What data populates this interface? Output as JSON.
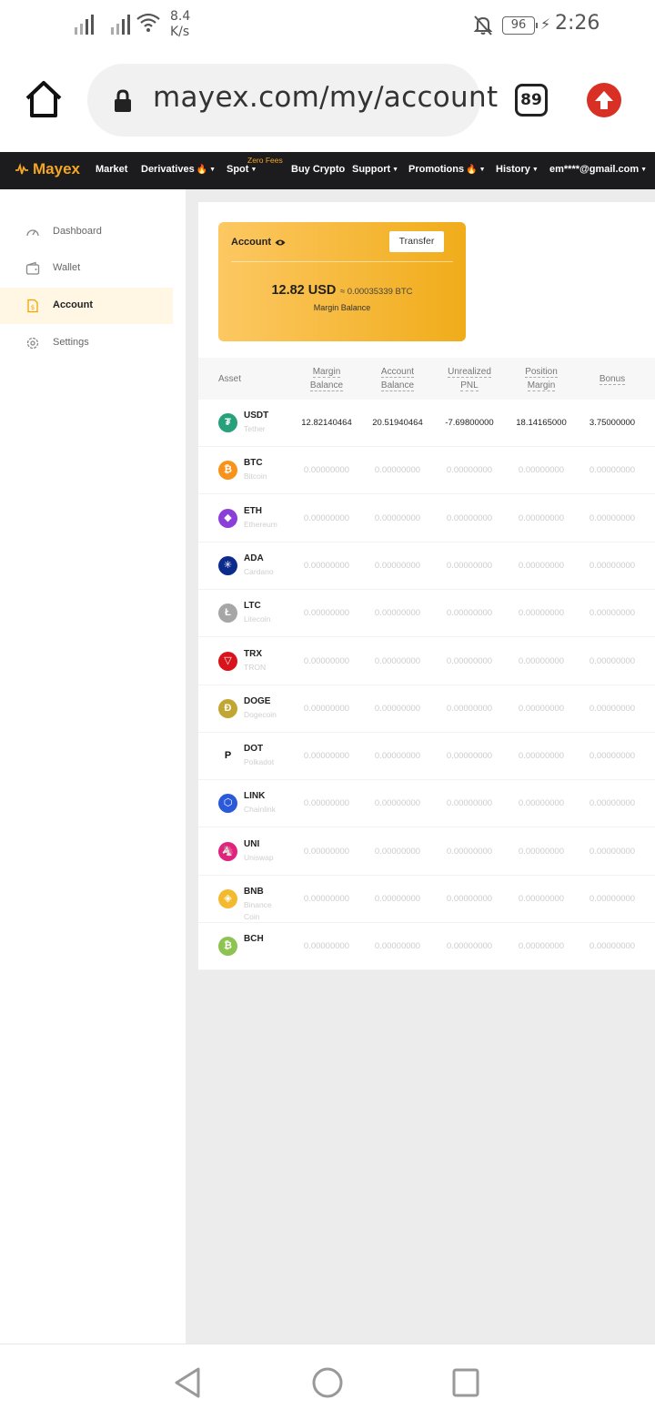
{
  "status_bar": {
    "speed_value": "8.4",
    "speed_unit": "K/s",
    "battery": "96",
    "time": "2:26"
  },
  "browser": {
    "url": "mayex.com/my/account",
    "tab_count": "89"
  },
  "site_nav": {
    "logo": "Mayex",
    "items": {
      "market": "Market",
      "derivatives": "Derivatives",
      "spot": "Spot",
      "spot_badge": "Zero Fees",
      "buy_crypto": "Buy Crypto",
      "support": "Support",
      "promotions": "Promotions",
      "history": "History",
      "account_email": "em****@gmail.com"
    }
  },
  "sidebar": {
    "items": [
      {
        "label": "Dashboard",
        "icon": "dashboard-icon"
      },
      {
        "label": "Wallet",
        "icon": "wallet-icon"
      },
      {
        "label": "Account",
        "icon": "account-icon",
        "active": true
      },
      {
        "label": "Settings",
        "icon": "settings-icon"
      }
    ]
  },
  "account_card": {
    "title": "Account",
    "transfer_label": "Transfer",
    "balance_usd": "12.82 USD",
    "balance_btc": "≈ 0.00035339 BTC",
    "balance_label": "Margin Balance"
  },
  "table": {
    "columns": {
      "asset": "Asset",
      "margin_balance": [
        "Margin",
        "Balance"
      ],
      "account_balance": [
        "Account",
        "Balance"
      ],
      "unrealized_pnl": [
        "Unrealized",
        "PNL"
      ],
      "position_margin": [
        "Position",
        "Margin"
      ],
      "bonus": "Bonus"
    },
    "rows": [
      {
        "symbol": "USDT",
        "name": "Tether",
        "color": "#26a17b",
        "glyph": "₮",
        "values": [
          "12.82140464",
          "20.51940464",
          "-7.69800000",
          "18.14165000",
          "3.75000000"
        ],
        "active": true
      },
      {
        "symbol": "BTC",
        "name": "Bitcoin",
        "color": "#f7931a",
        "glyph": "₿",
        "values": [
          "0.00000000",
          "0.00000000",
          "0.00000000",
          "0.00000000",
          "0.00000000"
        ]
      },
      {
        "symbol": "ETH",
        "name": "Ethereum",
        "color": "#8c3fd8",
        "glyph": "◆",
        "values": [
          "0.00000000",
          "0.00000000",
          "0.00000000",
          "0.00000000",
          "0.00000000"
        ]
      },
      {
        "symbol": "ADA",
        "name": "Cardano",
        "color": "#0d2b8c",
        "glyph": "✳",
        "values": [
          "0.00000000",
          "0.00000000",
          "0.00000000",
          "0.00000000",
          "0.00000000"
        ]
      },
      {
        "symbol": "LTC",
        "name": "Litecoin",
        "color": "#a6a6a6",
        "glyph": "Ł",
        "values": [
          "0.00000000",
          "0.00000000",
          "0.00000000",
          "0.00000000",
          "0.00000000"
        ]
      },
      {
        "symbol": "TRX",
        "name": "TRON",
        "color": "#d8131b",
        "glyph": "▽",
        "values": [
          "0.00000000",
          "0.00000000",
          "0.00000000",
          "0.00000000",
          "0.00000000"
        ]
      },
      {
        "symbol": "DOGE",
        "name": "Dogecoin",
        "color": "#c2a633",
        "glyph": "Ð",
        "values": [
          "0.00000000",
          "0.00000000",
          "0.00000000",
          "0.00000000",
          "0.00000000"
        ]
      },
      {
        "symbol": "DOT",
        "name": "Polkadot",
        "color": "#ffffff",
        "glyph": "P",
        "values": [
          "0.00000000",
          "0.00000000",
          "0.00000000",
          "0.00000000",
          "0.00000000"
        ]
      },
      {
        "symbol": "LINK",
        "name": "Chainlink",
        "color": "#2a5ada",
        "glyph": "⬡",
        "values": [
          "0.00000000",
          "0.00000000",
          "0.00000000",
          "0.00000000",
          "0.00000000"
        ]
      },
      {
        "symbol": "UNI",
        "name": "Uniswap",
        "color": "#e0237c",
        "glyph": "🦄",
        "values": [
          "0.00000000",
          "0.00000000",
          "0.00000000",
          "0.00000000",
          "0.00000000"
        ]
      },
      {
        "symbol": "BNB",
        "name": "Binance Coin",
        "color": "#f3ba2f",
        "glyph": "◈",
        "values": [
          "0.00000000",
          "0.00000000",
          "0.00000000",
          "0.00000000",
          "0.00000000"
        ]
      },
      {
        "symbol": "BCH",
        "name": "",
        "color": "#8dc351",
        "glyph": "₿",
        "values": [
          "0.00000000",
          "0.00000000",
          "0.00000000",
          "0.00000000",
          "0.00000000"
        ]
      }
    ]
  },
  "colors": {
    "brand": "#f5a623",
    "nav_bg": "#1c1c1e",
    "update": "#d93025"
  }
}
